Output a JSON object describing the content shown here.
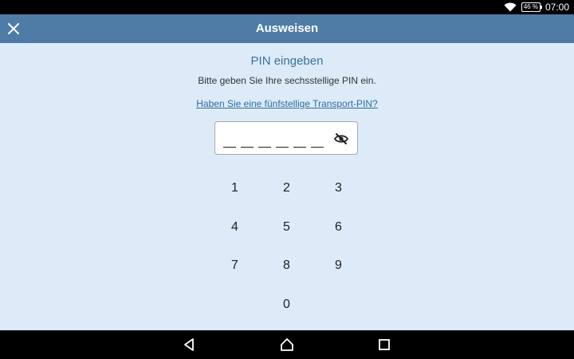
{
  "status_bar": {
    "battery": "46 %",
    "time": "07:00",
    "icons": [
      "wifi-icon",
      "battery-icon"
    ]
  },
  "app_bar": {
    "title": "Ausweisen",
    "close_icon": "close-icon",
    "color": "#4e7ca7"
  },
  "main": {
    "heading": "PIN eingeben",
    "instruction": "Bitte geben Sie Ihre sechsstellige PIN ein.",
    "transport_pin_link": "Haben Sie eine fünfstellige Transport-PIN?",
    "pin_input": {
      "value": "",
      "slots": 6,
      "visibility_icon": "eye-off-icon"
    },
    "keypad": {
      "keys": [
        "1",
        "2",
        "3",
        "4",
        "5",
        "6",
        "7",
        "8",
        "9",
        "",
        "0",
        ""
      ]
    }
  },
  "nav_bar": {
    "icons": [
      "back-icon",
      "home-icon",
      "recents-icon"
    ]
  },
  "colors": {
    "background": "#dcebf7",
    "heading": "#3f6f9c",
    "link": "#2f6c9e"
  }
}
